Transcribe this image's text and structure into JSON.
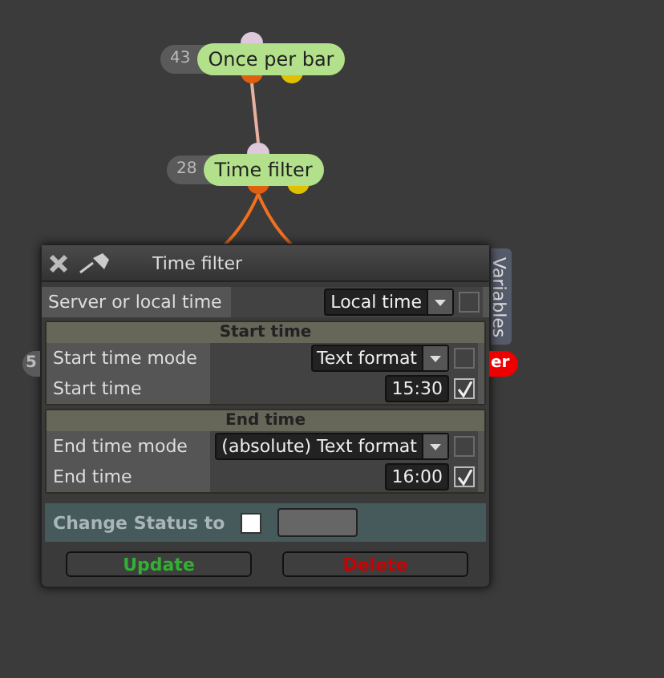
{
  "nodes": [
    {
      "number": "43",
      "label": "Once per bar"
    },
    {
      "number": "28",
      "label": "Time filter"
    }
  ],
  "hidden_nodes": [
    {
      "text": "5",
      "kind": "left"
    },
    {
      "text": "er",
      "kind": "right"
    }
  ],
  "side_tab": {
    "label": "Variables"
  },
  "dialog": {
    "title": "Time filter",
    "top_rows": [
      {
        "kind": "dropdown",
        "label": "Server or local time",
        "value": "Local time",
        "checked": false
      }
    ],
    "sections": [
      {
        "title": "Start time",
        "rows": [
          {
            "kind": "dropdown",
            "label": "Start time mode",
            "value": "Text format",
            "checked": false
          },
          {
            "kind": "time",
            "label": "Start time",
            "value": "15:30",
            "checked": true
          }
        ]
      },
      {
        "title": "End time",
        "rows": [
          {
            "kind": "dropdown",
            "label": "End time mode",
            "value": "(absolute) Text format",
            "checked": false
          },
          {
            "kind": "time",
            "label": "End time",
            "value": "16:00",
            "checked": true
          }
        ]
      }
    ],
    "status": {
      "label": "Change Status to",
      "checked": false
    },
    "buttons": [
      {
        "label": "Update",
        "kind": "update"
      },
      {
        "label": "Delete",
        "kind": "delete"
      }
    ]
  }
}
